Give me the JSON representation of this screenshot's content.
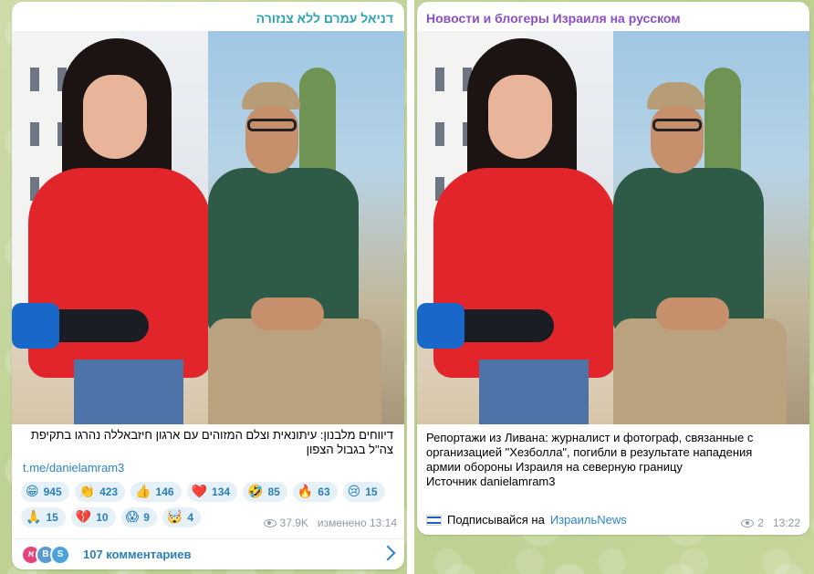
{
  "left_post": {
    "channel": "דניאל עמרם ללא צנזורה",
    "text": "דיווחים מלבנון: עיתונאית וצלם המזוהים עם ארגון חיזבאללה נהרגו בתקיפת צה\"ל בגבול הצפון",
    "link": "t.me/danielamram3",
    "reactions": [
      {
        "emoji": "😁",
        "count": "945"
      },
      {
        "emoji": "👏",
        "count": "423"
      },
      {
        "emoji": "👍",
        "count": "146"
      },
      {
        "emoji": "❤️",
        "count": "134"
      },
      {
        "emoji": "🤣",
        "count": "85"
      },
      {
        "emoji": "🔥",
        "count": "63"
      },
      {
        "emoji": "😢",
        "count": "15"
      },
      {
        "emoji": "🙏",
        "count": "15"
      },
      {
        "emoji": "💔",
        "count": "10"
      },
      {
        "emoji": "😱",
        "count": "9"
      },
      {
        "emoji": "🤯",
        "count": "4"
      }
    ],
    "views": "37.9K",
    "edited_time": "изменено 13:14",
    "comments": {
      "avatars": [
        {
          "letter": "א",
          "color": "#e5457a"
        },
        {
          "letter": "B",
          "color": "#5b9bd5"
        },
        {
          "letter": "S",
          "color": "#4aa3df"
        }
      ],
      "label": "107 комментариев"
    }
  },
  "right_post": {
    "channel": "Новости и блогеры Израиля на русском",
    "text_lines": [
      "Репортажи из Ливана: журналист и фотограф, связанные с",
      "организацией \"Хезболла\", погибли в результате нападения",
      "армии обороны Израиля на северную границу",
      "Источник danielamram3"
    ],
    "subscribe_prefix": "Подписывайся на",
    "subscribe_link": "ИзраильNews",
    "views": "2",
    "time": "13:22"
  }
}
